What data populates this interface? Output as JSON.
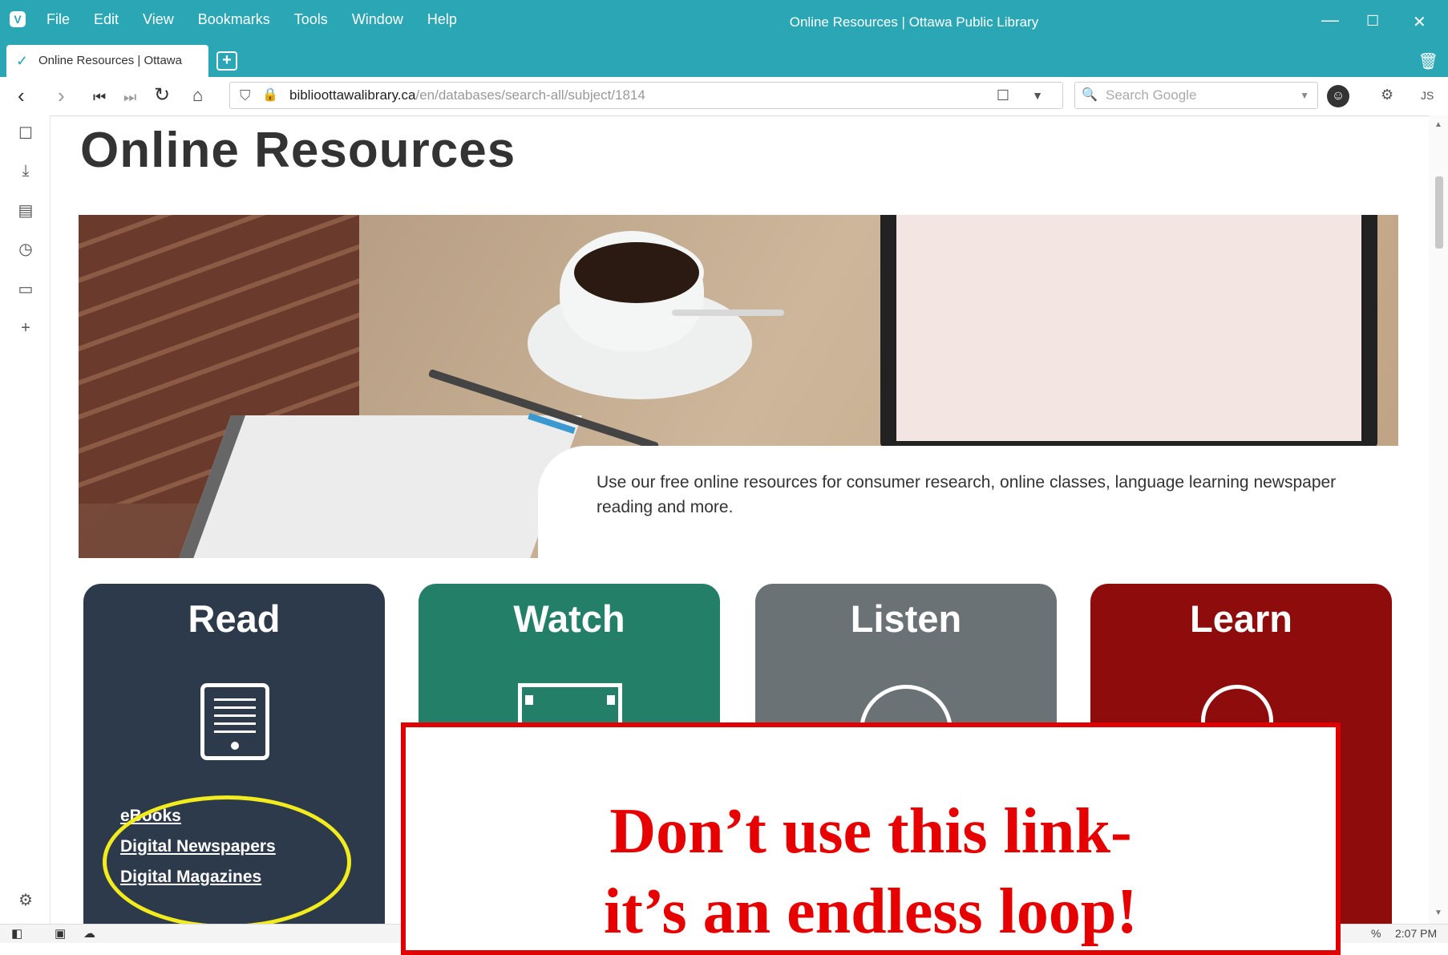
{
  "window": {
    "title": "Online Resources | Ottawa Public Library",
    "menu": [
      "File",
      "Edit",
      "View",
      "Bookmarks",
      "Tools",
      "Window",
      "Help"
    ],
    "controls": {
      "minimize": "—",
      "maximize": "☐",
      "close": "✕"
    }
  },
  "tabs": {
    "active_label": "Online Resources | Ottawa"
  },
  "address": {
    "host": "biblioottawalibrary.ca",
    "path": "/en/databases/search-all/subject/1814",
    "search_placeholder": "Search Google",
    "profile": "JS"
  },
  "page": {
    "title": "Online Resources",
    "caption": "Use our free online resources for consumer research, online classes, language learning newspaper reading and more."
  },
  "cards": {
    "read": {
      "title": "Read",
      "links": [
        "eBooks",
        "Digital Newspapers",
        "Digital Magazines"
      ]
    },
    "watch": {
      "title": "Watch"
    },
    "listen": {
      "title": "Listen"
    },
    "learn": {
      "title": "Learn"
    }
  },
  "status": {
    "zoom": "%",
    "clock": "2:07 PM"
  },
  "overlay": {
    "line1": "Don’t use this link-",
    "line2": "it’s an endless loop!"
  },
  "colors": {
    "brand_teal": "#2aa6b4",
    "read": "#2d3a4b",
    "watch": "#237f68",
    "listen": "#6a7276",
    "learn": "#8f0c0c",
    "warning": "#e60000",
    "highlight": "#f2ec1e"
  }
}
